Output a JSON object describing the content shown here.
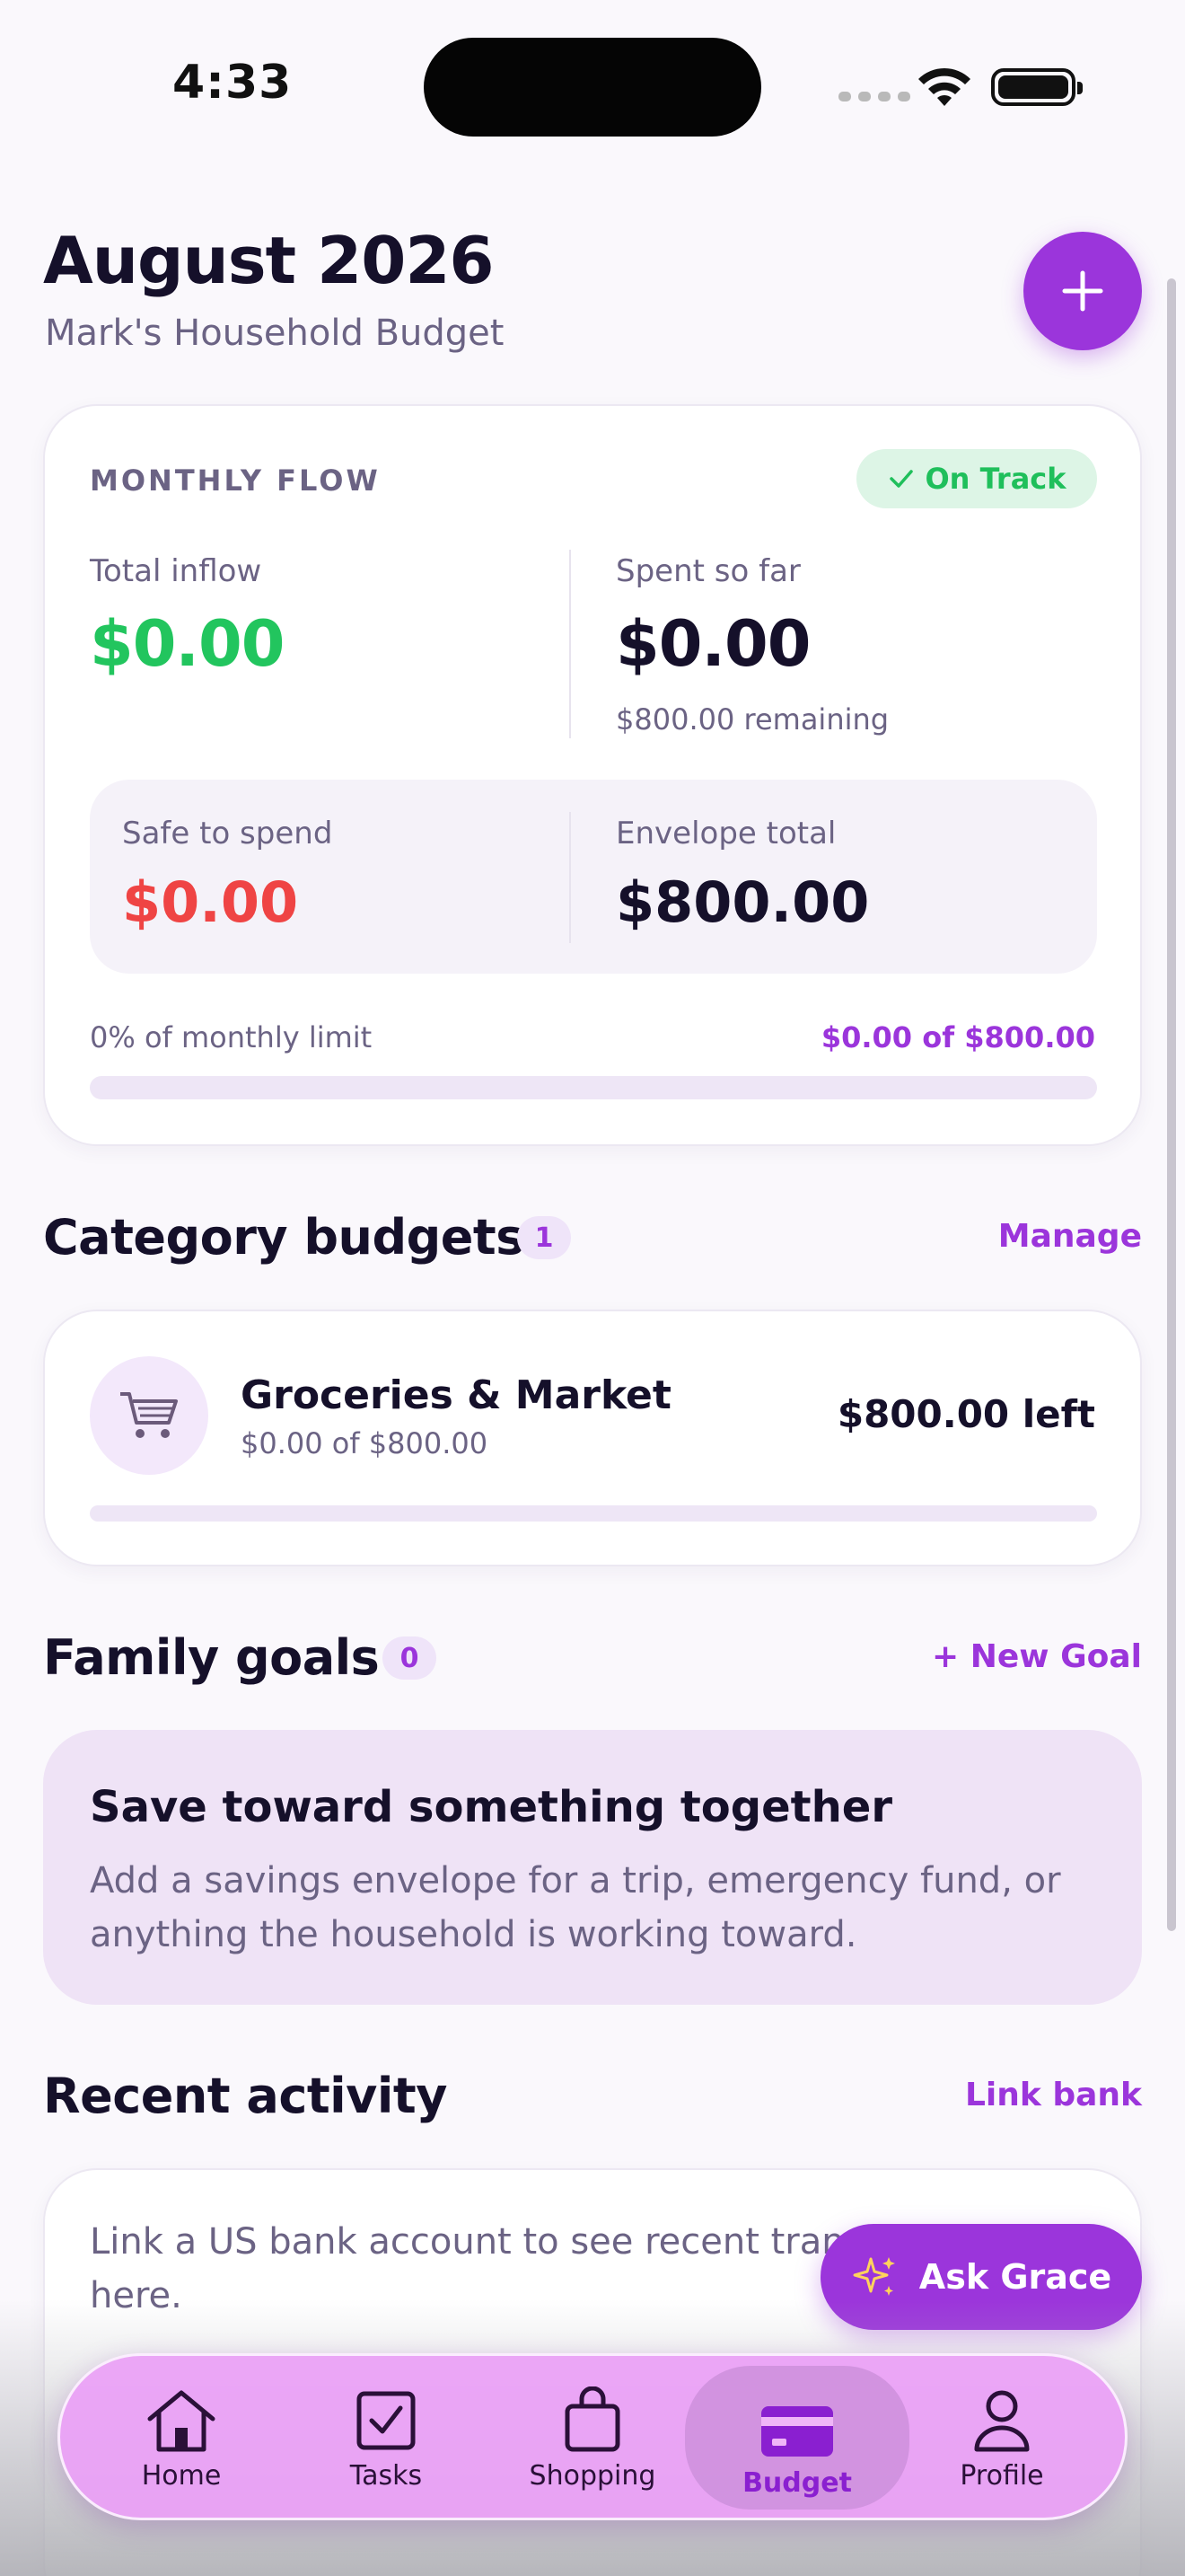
{
  "status_bar": {
    "time": "4:33"
  },
  "header": {
    "title": "August 2026",
    "subtitle": "Mark's Household Budget"
  },
  "monthly_flow": {
    "label": "MONTHLY FLOW",
    "status_badge": "On Track",
    "total_inflow_label": "Total inflow",
    "total_inflow_value": "$0.00",
    "spent_label": "Spent so far",
    "spent_value": "$0.00",
    "remaining_text": "$800.00 remaining",
    "safe_to_spend_label": "Safe to spend",
    "safe_to_spend_value": "$0.00",
    "envelope_total_label": "Envelope total",
    "envelope_total_value": "$800.00",
    "limit_percent_text": "0% of monthly limit",
    "limit_amount_text": "$0.00 of $800.00",
    "progress": 0
  },
  "category_budgets": {
    "title": "Category budgets",
    "count": "1",
    "manage_label": "Manage",
    "items": [
      {
        "icon": "shopping-cart-icon",
        "name": "Groceries & Market",
        "subtext": "$0.00 of $800.00",
        "left": "$800.00 left",
        "progress": 0
      }
    ]
  },
  "family_goals": {
    "title": "Family goals",
    "count": "0",
    "new_goal_label": "+ New Goal",
    "empty_title": "Save toward something together",
    "empty_text": "Add a savings envelope for a trip, emergency fund, or anything the household is working toward."
  },
  "recent_activity": {
    "title": "Recent activity",
    "link_bank_label": "Link bank",
    "empty_text": "Link a US bank account to see recent transactions here."
  },
  "ask_grace": {
    "label": "Ask Grace"
  },
  "tabs": [
    {
      "label": "Home",
      "icon": "home-icon"
    },
    {
      "label": "Tasks",
      "icon": "checkbox-icon"
    },
    {
      "label": "Shopping",
      "icon": "shopping-bag-icon"
    },
    {
      "label": "Budget",
      "icon": "credit-card-icon",
      "active": true
    },
    {
      "label": "Profile",
      "icon": "person-icon"
    }
  ],
  "colors": {
    "accent": "#9b35db",
    "positive": "#22c55e",
    "negative": "#ef4444",
    "text_dark": "#15102a",
    "text_muted": "#6b6384"
  }
}
